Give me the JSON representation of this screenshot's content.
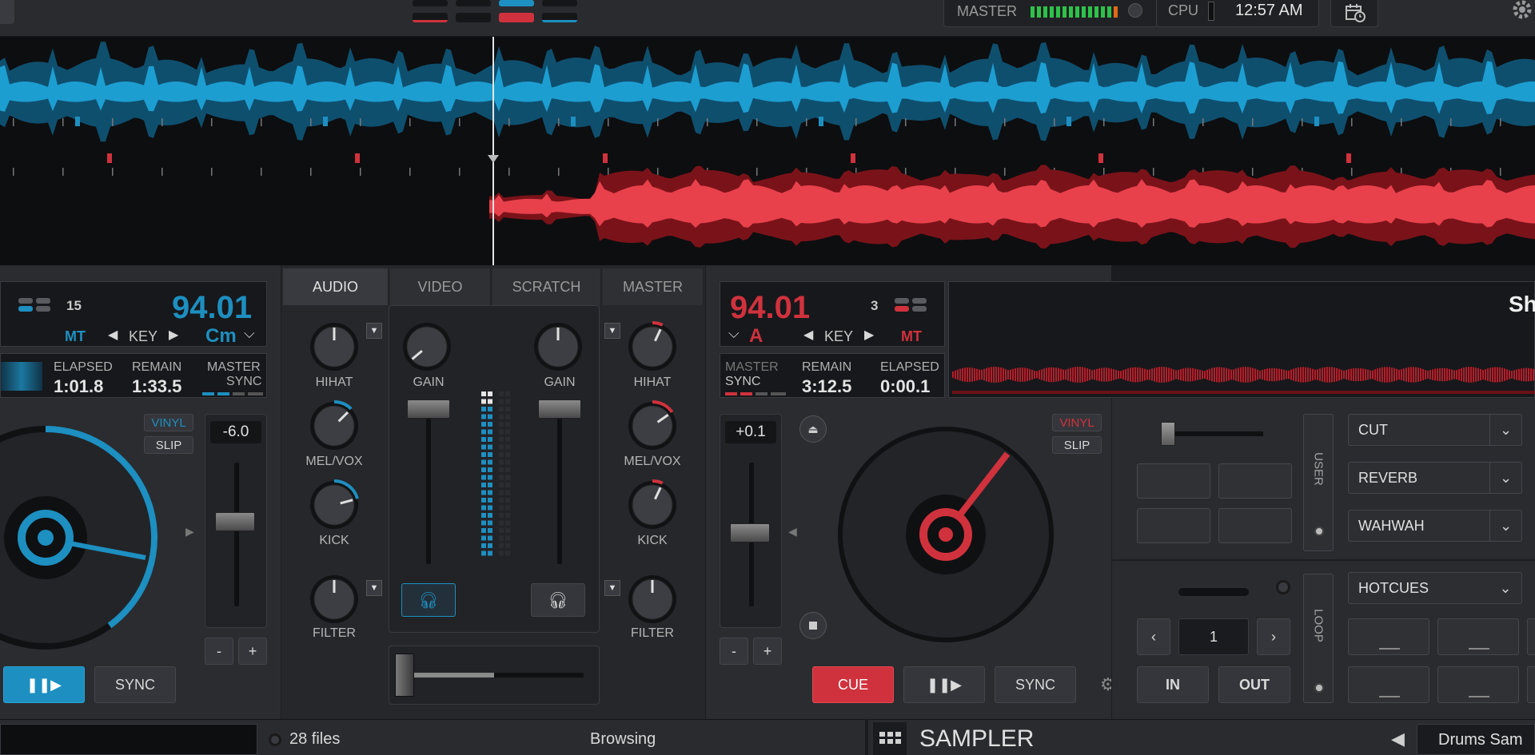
{
  "topbar": {
    "master_label": "MASTER",
    "cpu_label": "CPU",
    "clock": "12:57 AM"
  },
  "left_deck": {
    "key_count": "15",
    "bpm": "94.01",
    "mt": "MT",
    "key_label": "KEY",
    "key_value": "Cm",
    "elapsed_label": "ELAPSED",
    "elapsed_value": "1:01.8",
    "remain_label": "REMAIN",
    "remain_value": "1:33.5",
    "master_label": "MASTER",
    "sync_label": "SYNC",
    "vinyl": "VINYL",
    "slip": "SLIP",
    "pitch": "-6.0",
    "minus": "-",
    "plus": "+",
    "sync_button": "SYNC",
    "accent": "#1d8fc0"
  },
  "mixer": {
    "tabs": [
      "AUDIO",
      "VIDEO",
      "SCRATCH",
      "MASTER"
    ],
    "hihat": "HIHAT",
    "melvox": "MEL/VOX",
    "kick": "KICK",
    "filter": "FILTER",
    "gain": "GAIN"
  },
  "right_deck": {
    "bpm": "94.01",
    "key_count": "3",
    "key_value": "A",
    "key_label": "KEY",
    "mt": "MT",
    "master_label": "MASTER",
    "sync_label": "SYNC",
    "remain_label": "REMAIN",
    "remain_value": "3:12.5",
    "elapsed_label": "ELAPSED",
    "elapsed_value": "0:00.1",
    "title": "Sh",
    "vinyl": "VINYL",
    "slip": "SLIP",
    "pitch": "+0.1",
    "minus": "-",
    "plus": "+",
    "cue": "CUE",
    "sync_button": "SYNC",
    "accent": "#d0323d"
  },
  "fx": {
    "user_label": "USER",
    "effects": [
      "CUT",
      "REVERB",
      "WAHWAH"
    ],
    "loop_label": "LOOP",
    "loop_value": "1",
    "in": "IN",
    "out": "OUT",
    "pads_mode": "HOTCUES"
  },
  "bottombar": {
    "files": "28 files",
    "browsing": "Browsing",
    "sampler": "SAMPLER",
    "sampler_bank": "Drums Sam"
  }
}
